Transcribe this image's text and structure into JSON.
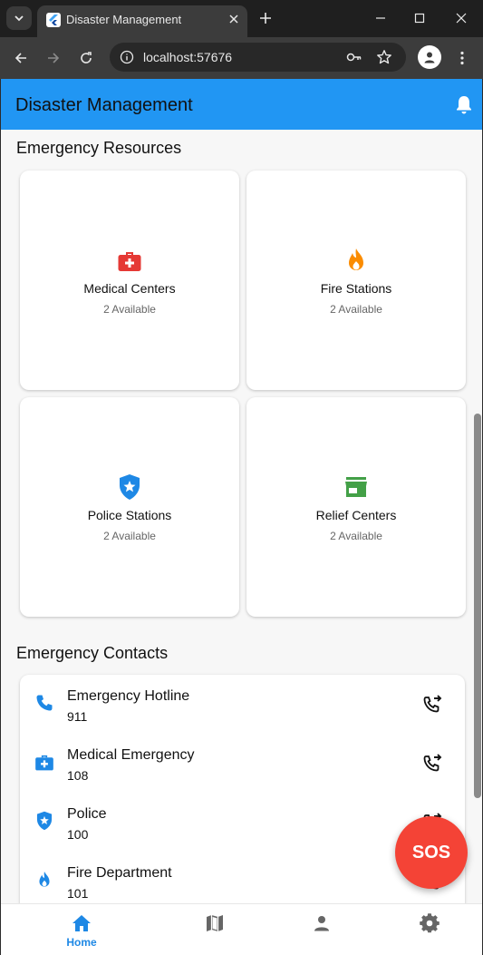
{
  "browser": {
    "tab_title": "Disaster Management",
    "url": "localhost:57676"
  },
  "app": {
    "title": "Disaster Management"
  },
  "resources": {
    "title": "Emergency Resources",
    "items": [
      {
        "name": "Medical Centers",
        "sub": "2 Available",
        "icon": "medical-kit-icon",
        "color": "#e53935"
      },
      {
        "name": "Fire Stations",
        "sub": "2 Available",
        "icon": "fire-icon",
        "color": "#fb8c00"
      },
      {
        "name": "Police Stations",
        "sub": "2 Available",
        "icon": "police-shield-icon",
        "color": "#1e88e5"
      },
      {
        "name": "Relief Centers",
        "sub": "2 Available",
        "icon": "store-icon",
        "color": "#43a047"
      }
    ]
  },
  "contacts": {
    "title": "Emergency Contacts",
    "items": [
      {
        "name": "Emergency Hotline",
        "number": "911",
        "icon": "phone-icon"
      },
      {
        "name": "Medical Emergency",
        "number": "108",
        "icon": "medical-kit-icon"
      },
      {
        "name": "Police",
        "number": "100",
        "icon": "police-shield-icon"
      },
      {
        "name": "Fire Department",
        "number": "101",
        "icon": "fire-icon"
      }
    ]
  },
  "sos_label": "SOS",
  "nav": {
    "items": [
      {
        "label": "Home",
        "icon": "home-icon",
        "active": true
      },
      {
        "label": "",
        "icon": "map-icon",
        "active": false
      },
      {
        "label": "",
        "icon": "person-icon",
        "active": false
      },
      {
        "label": "",
        "icon": "settings-icon",
        "active": false
      }
    ]
  },
  "colors": {
    "primary": "#2196f3",
    "accent": "#1e88e5",
    "sos": "#f44336"
  }
}
